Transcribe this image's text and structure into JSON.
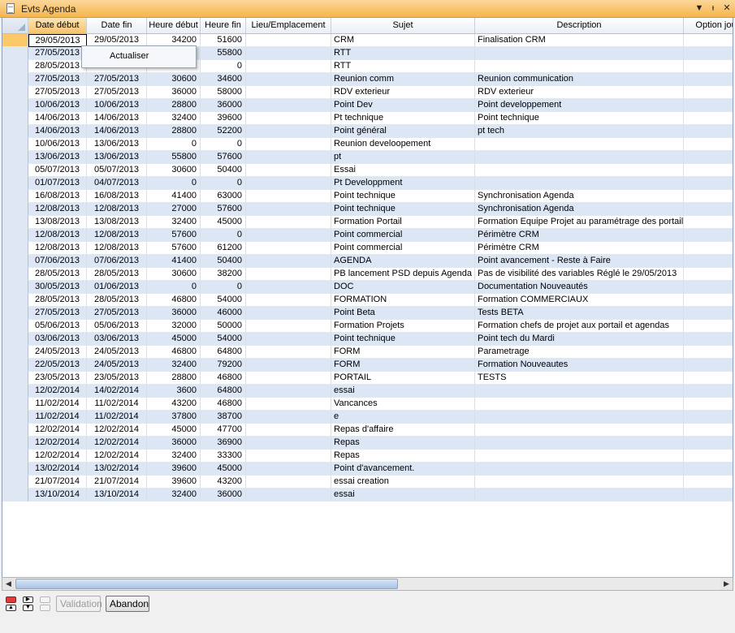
{
  "window": {
    "title": "Evts Agenda",
    "controls": [
      "▼",
      "ᵻ",
      "✕"
    ]
  },
  "columns": [
    {
      "label": "Date début",
      "align": "date",
      "width": 72,
      "selected": true
    },
    {
      "label": "Date fin",
      "align": "date",
      "width": 74
    },
    {
      "label": "Heure début",
      "align": "num",
      "width": 66
    },
    {
      "label": "Heure fin",
      "align": "num",
      "width": 56
    },
    {
      "label": "Lieu/Emplacement",
      "align": "left",
      "width": 105
    },
    {
      "label": "Sujet",
      "align": "left",
      "width": 177
    },
    {
      "label": "Description",
      "align": "left",
      "width": 257
    },
    {
      "label": "Option jou",
      "align": "left",
      "width": 80
    }
  ],
  "rows": [
    [
      "29/05/2013",
      "29/05/2013",
      "34200",
      "51600",
      "",
      "CRM",
      "Finalisation CRM",
      ""
    ],
    [
      "27/05/2013",
      "",
      "",
      "55800",
      "",
      "RTT",
      "",
      ""
    ],
    [
      "28/05/2013",
      "",
      "",
      "0",
      "",
      "RTT",
      "",
      ""
    ],
    [
      "27/05/2013",
      "27/05/2013",
      "30600",
      "34600",
      "",
      "Reunion comm",
      "Reunion communication",
      ""
    ],
    [
      "27/05/2013",
      "27/05/2013",
      "36000",
      "58000",
      "",
      "RDV exterieur",
      "RDV exterieur",
      ""
    ],
    [
      "10/06/2013",
      "10/06/2013",
      "28800",
      "36000",
      "",
      "Point Dev",
      "Point developpement",
      ""
    ],
    [
      "14/06/2013",
      "14/06/2013",
      "32400",
      "39600",
      "",
      "Pt technique",
      "Point technique",
      ""
    ],
    [
      "14/06/2013",
      "14/06/2013",
      "28800",
      "52200",
      "",
      "Point général",
      "pt tech",
      ""
    ],
    [
      "10/06/2013",
      "13/06/2013",
      "0",
      "0",
      "",
      "Reunion develoopement",
      "",
      ""
    ],
    [
      "13/06/2013",
      "13/06/2013",
      "55800",
      "57600",
      "",
      "pt",
      "",
      ""
    ],
    [
      "05/07/2013",
      "05/07/2013",
      "30600",
      "50400",
      "",
      "Essai",
      "",
      ""
    ],
    [
      "01/07/2013",
      "04/07/2013",
      "0",
      "0",
      "",
      "Pt Developpment",
      "",
      ""
    ],
    [
      "16/08/2013",
      "16/08/2013",
      "41400",
      "63000",
      "",
      "Point technique",
      "Synchronisation Agenda",
      ""
    ],
    [
      "12/08/2013",
      "12/08/2013",
      "27000",
      "57600",
      "",
      "Point technique",
      "Synchronisation Agenda",
      ""
    ],
    [
      "13/08/2013",
      "13/08/2013",
      "32400",
      "45000",
      "",
      "Formation Portail",
      "Formation Equipe Projet au paramétrage des portails",
      ""
    ],
    [
      "12/08/2013",
      "12/08/2013",
      "57600",
      "0",
      "",
      "Point commercial",
      "Périmètre CRM",
      ""
    ],
    [
      "12/08/2013",
      "12/08/2013",
      "57600",
      "61200",
      "",
      "Point commercial",
      "Périmètre CRM",
      ""
    ],
    [
      "07/06/2013",
      "07/06/2013",
      "41400",
      "50400",
      "",
      "AGENDA",
      "Point avancement - Reste à Faire",
      ""
    ],
    [
      "28/05/2013",
      "28/05/2013",
      "30600",
      "38200",
      "",
      "PB lancement PSD depuis Agenda",
      "Pas de visibilité des variables Réglé le 29/05/2013",
      ""
    ],
    [
      "30/05/2013",
      "01/06/2013",
      "0",
      "0",
      "",
      "DOC",
      "Documentation Nouveautés",
      ""
    ],
    [
      "28/05/2013",
      "28/05/2013",
      "46800",
      "54000",
      "",
      "FORMATION",
      "Formation COMMERCIAUX",
      ""
    ],
    [
      "27/05/2013",
      "27/05/2013",
      "36000",
      "46000",
      "",
      "Point Beta",
      "Tests BETA",
      ""
    ],
    [
      "05/06/2013",
      "05/06/2013",
      "32000",
      "50000",
      "",
      "Formation Projets",
      "Formation chefs de projet aux portail et agendas",
      ""
    ],
    [
      "03/06/2013",
      "03/06/2013",
      "45000",
      "54000",
      "",
      "Point technique",
      "Point tech du Mardi",
      ""
    ],
    [
      "24/05/2013",
      "24/05/2013",
      "46800",
      "64800",
      "",
      "FORM",
      "Parametrage",
      ""
    ],
    [
      "22/05/2013",
      "24/05/2013",
      "32400",
      "79200",
      "",
      "FORM",
      "Formation Nouveautes",
      ""
    ],
    [
      "23/05/2013",
      "23/05/2013",
      "28800",
      "46800",
      "",
      "PORTAIL",
      "TESTS",
      ""
    ],
    [
      "12/02/2014",
      "14/02/2014",
      "3600",
      "64800",
      "",
      "essai",
      "",
      ""
    ],
    [
      "11/02/2014",
      "11/02/2014",
      "43200",
      "46800",
      "",
      "Vancances",
      "",
      ""
    ],
    [
      "11/02/2014",
      "11/02/2014",
      "37800",
      "38700",
      "",
      "e",
      "",
      ""
    ],
    [
      "12/02/2014",
      "12/02/2014",
      "45000",
      "47700",
      "",
      "Repas d'affaire",
      "",
      ""
    ],
    [
      "12/02/2014",
      "12/02/2014",
      "36000",
      "36900",
      "",
      "Repas",
      "",
      ""
    ],
    [
      "12/02/2014",
      "12/02/2014",
      "32400",
      "33300",
      "",
      "Repas",
      "",
      ""
    ],
    [
      "13/02/2014",
      "13/02/2014",
      "39600",
      "45000",
      "",
      "Point d'avancement.",
      "",
      ""
    ],
    [
      "21/07/2014",
      "21/07/2014",
      "39600",
      "43200",
      "",
      "essai creation",
      "",
      ""
    ],
    [
      "13/10/2014",
      "13/10/2014",
      "32400",
      "36000",
      "",
      "essai",
      "",
      ""
    ]
  ],
  "context_menu": {
    "items": [
      "Actualiser"
    ]
  },
  "toolbar": {
    "validation_label": "Validation",
    "abandon_label": "Abandon"
  },
  "colors": {
    "titlebar": "#f6b64c",
    "row_alt": "#dce6f4",
    "selection": "#fbc86a"
  }
}
